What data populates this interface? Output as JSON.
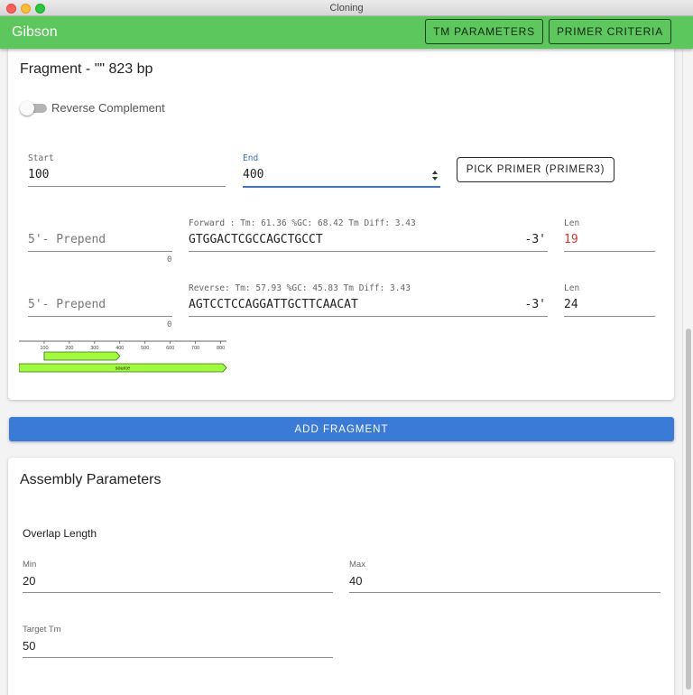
{
  "window": {
    "title": "Cloning"
  },
  "appbar": {
    "title": "Gibson",
    "tm_parameters_label": "TM PARAMETERS",
    "primer_criteria_label": "PRIMER CRITERIA"
  },
  "fragment": {
    "title": "Fragment - \"\" 823 bp",
    "reverse_complement_label": "Reverse Complement",
    "reverse_complement_on": false,
    "start": {
      "label": "Start",
      "value": "100"
    },
    "end": {
      "label": "End",
      "value": "400"
    },
    "pick_primer_label": "PICK PRIMER (PRIMER3)",
    "forward": {
      "prepend_placeholder": "5'- Prepend",
      "prepend_count": "0",
      "info": "Forward : Tm: 61.36 %GC: 68.42 Tm Diff: 3.43",
      "sequence": "GTGGACTCGCCAGCTGCCT",
      "suffix": "-3'",
      "len_label": "Len",
      "len_value": "19"
    },
    "reverse": {
      "prepend_placeholder": "5'- Prepend",
      "prepend_count": "0",
      "info": "Reverse: Tm: 57.93 %GC: 45.83 Tm Diff: 3.43",
      "sequence": "AGTCCTCCAGGATTGCTTCAACAT",
      "suffix": "-3'",
      "len_label": "Len",
      "len_value": "24"
    },
    "map": {
      "ticks": [
        "100",
        "200",
        "300",
        "400",
        "500",
        "600",
        "700",
        "800"
      ],
      "total_bp": 823,
      "selected_range": [
        100,
        400
      ],
      "feature_label": "source",
      "feature_color": "#9efc3a"
    }
  },
  "add_fragment_label": "ADD FRAGMENT",
  "assembly": {
    "title": "Assembly Parameters",
    "overlap_title": "Overlap Length",
    "min": {
      "label": "Min",
      "value": "20"
    },
    "max": {
      "label": "Max",
      "value": "40"
    },
    "target_tm": {
      "label": "Target Tm",
      "value": "50"
    }
  }
}
